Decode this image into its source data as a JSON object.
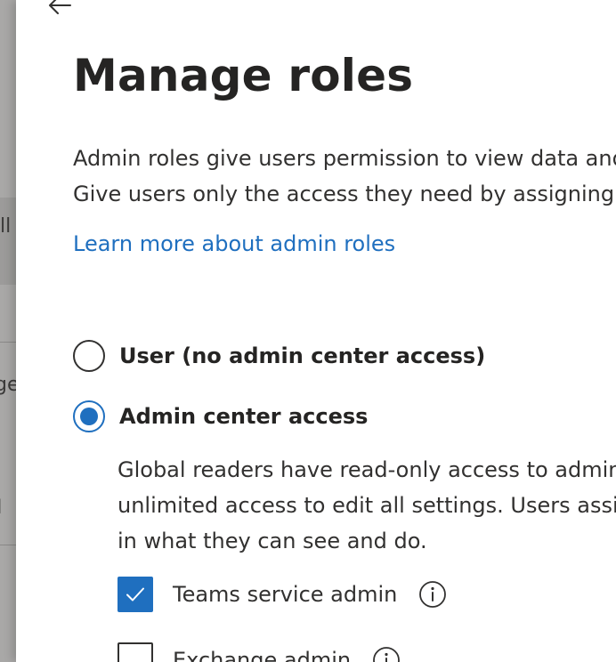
{
  "backdrop": {
    "fragments": [
      "ll",
      "ge",
      "I",
      "("
    ]
  },
  "panel": {
    "back_icon": "arrow-left-icon",
    "title": "Manage roles",
    "description_lines": [
      "Admin roles give users permission to view data and complete tasks in admin centers.",
      "Give users only the access they need by assigning the least-permissive role."
    ],
    "learn_more_link": "Learn more about admin roles",
    "role_options": [
      {
        "label": "User (no admin center access)",
        "selected": false
      },
      {
        "label": "Admin center access",
        "selected": true
      }
    ],
    "admin_info_lines": [
      "Global readers have read-only access to admin center data, while Global admins have",
      "unlimited access to edit all settings. Users assigned other roles are more limited",
      "in what they can see and do."
    ],
    "roles": [
      {
        "label": "Teams service admin",
        "checked": true,
        "info_icon": "info-icon"
      },
      {
        "label": "Exchange admin",
        "checked": false,
        "info_icon": "info-icon"
      }
    ]
  },
  "colors": {
    "accent": "#1f6fbf",
    "text": "#323130",
    "backdrop": "#a9a8a7"
  }
}
